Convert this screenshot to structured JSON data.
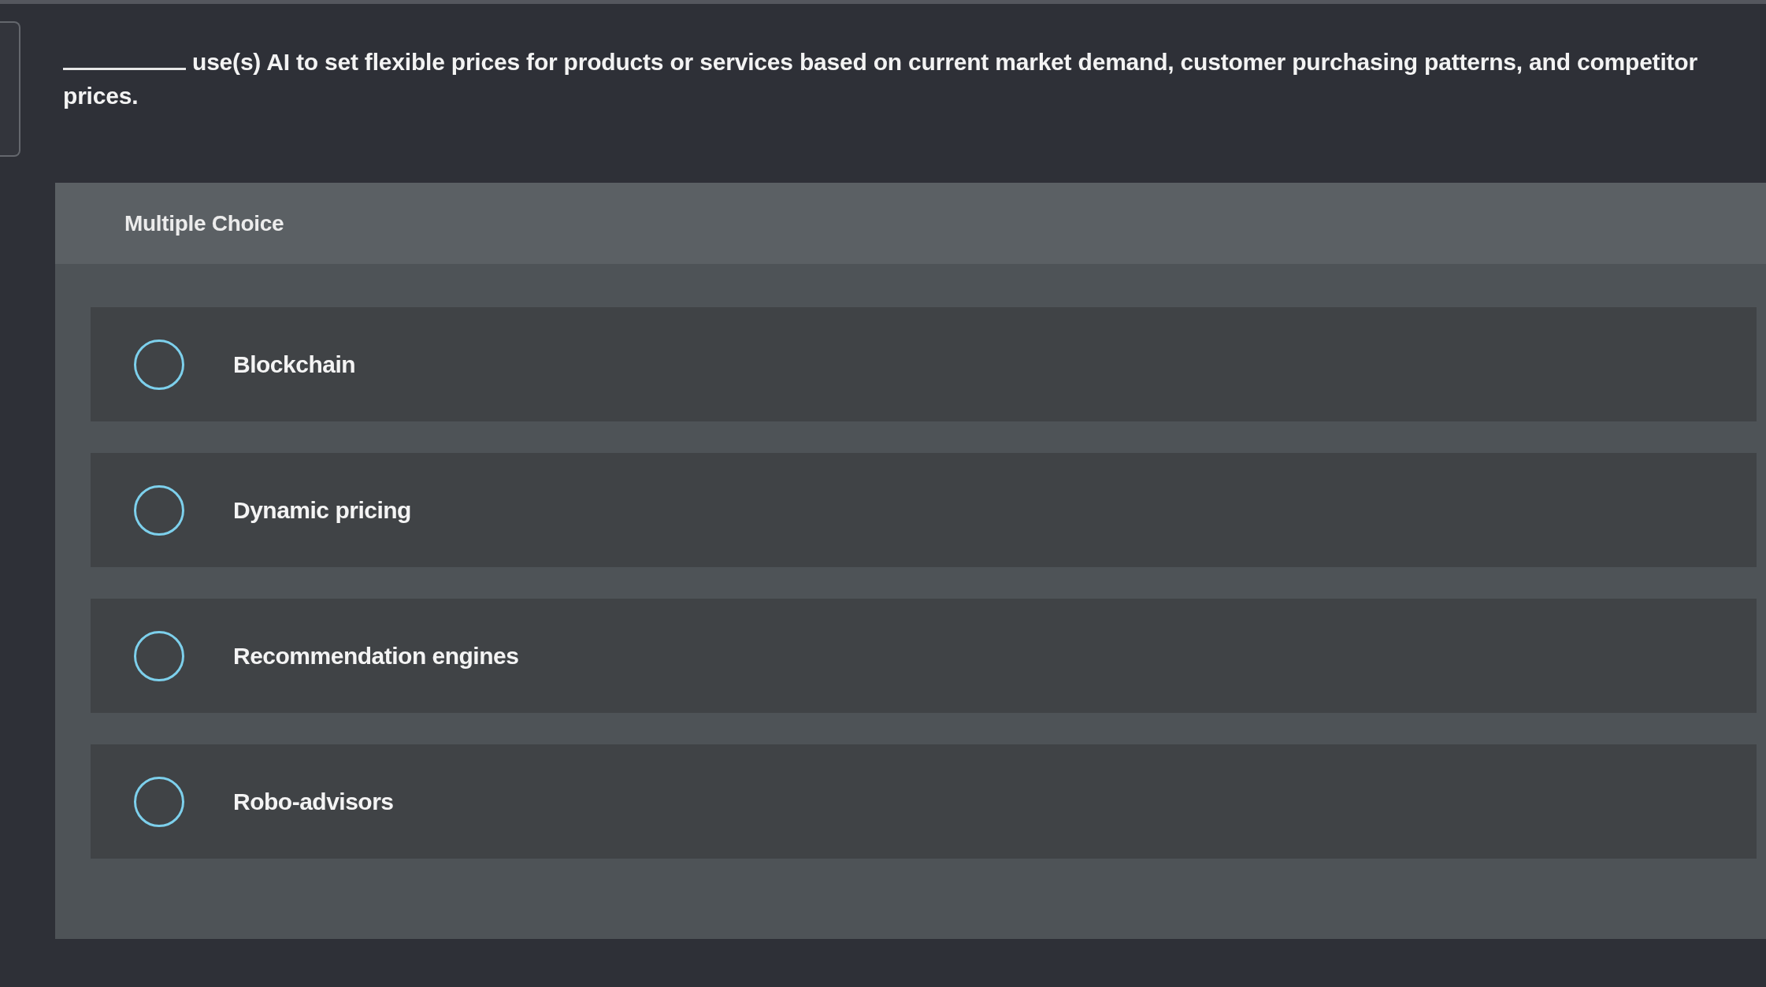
{
  "question": {
    "blank": true,
    "text": "use(s) AI to set flexible prices for products or services based on current market demand, customer purchasing patterns, and competitor prices."
  },
  "answer_panel": {
    "type_label": "Multiple Choice",
    "options": [
      {
        "label": "Blockchain",
        "selected": false
      },
      {
        "label": "Dynamic pricing",
        "selected": false
      },
      {
        "label": "Recommendation engines",
        "selected": false
      },
      {
        "label": "Robo-advisors",
        "selected": false
      }
    ]
  }
}
